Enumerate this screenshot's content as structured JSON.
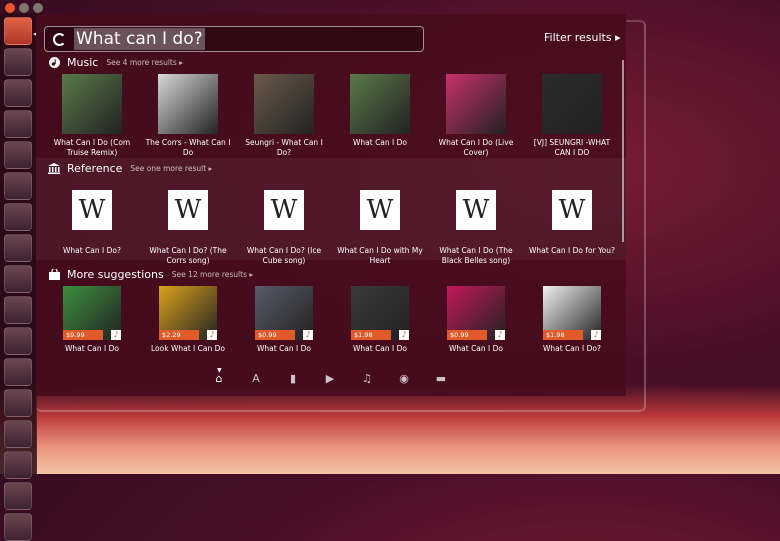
{
  "search": {
    "query": "What can I do?"
  },
  "filter_results": "Filter results ▸",
  "categories": {
    "music": {
      "title": "Music",
      "more": "See 4 more results"
    },
    "reference": {
      "title": "Reference",
      "more": "See one more result"
    },
    "more": {
      "title": "More suggestions",
      "more": "See 12 more results"
    }
  },
  "music_items": [
    {
      "label": "What Can I Do (Com Truise Remix)",
      "color": "#5a7a4a"
    },
    {
      "label": "The Corrs - What Can I Do",
      "color": "#d8d8d8"
    },
    {
      "label": "Seungri - What Can I Do?",
      "color": "#6b5a4a"
    },
    {
      "label": "What Can I Do",
      "color": "#5a7a4a"
    },
    {
      "label": "What Can I Do (Live Cover)",
      "color": "#c9306b"
    },
    {
      "label": "[VJ] SEUNGRI -WHAT CAN I DO",
      "color": "#2b2b2b"
    }
  ],
  "reference_items": [
    {
      "label": "What Can I Do?",
      "glyph": "W"
    },
    {
      "label": "What Can I Do? (The Corrs song)",
      "glyph": "W"
    },
    {
      "label": "What Can I Do? (Ice Cube song)",
      "glyph": "W"
    },
    {
      "label": "What Can I Do with My Heart",
      "glyph": "W"
    },
    {
      "label": "What Can I Do (The Black Belles song)",
      "glyph": "W"
    },
    {
      "label": "What Can I Do for You?",
      "glyph": "W"
    }
  ],
  "suggestion_items": [
    {
      "label": "What Can I Do",
      "price": "$9.99",
      "color": "#3c8f3f"
    },
    {
      "label": "Look What I Can Do",
      "price": "$2.29",
      "color": "#d9a21b"
    },
    {
      "label": "What Can I Do",
      "price": "$0.99",
      "color": "#5a5a6a"
    },
    {
      "label": "What Can I Do",
      "price": "$1.98",
      "color": "#3a3a3a"
    },
    {
      "label": "What Can I Do",
      "price": "$0.99",
      "color": "#c2185b"
    },
    {
      "label": "What Can I Do?",
      "price": "$1.98",
      "color": "#f0f0f0"
    }
  ],
  "lenses": [
    "home-lens",
    "apps-lens",
    "files-lens",
    "video-lens",
    "music-lens",
    "photo-lens",
    "social-lens"
  ]
}
